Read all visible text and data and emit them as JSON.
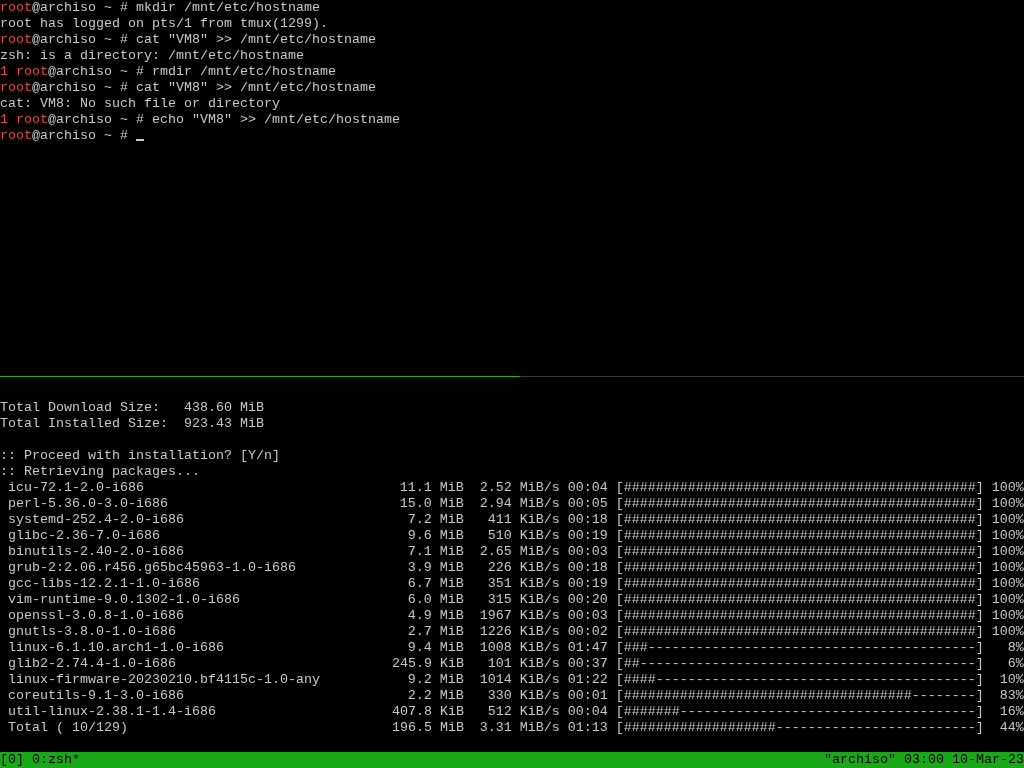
{
  "top_pane": {
    "lines": [
      {
        "kind": "prompt",
        "user": "root",
        "host": "@archiso ~ #",
        "command": "mkdir /mnt/etc/hostname"
      },
      {
        "kind": "output",
        "text": "root has logged on pts/1 from tmux(1299)."
      },
      {
        "kind": "prompt",
        "user": "root",
        "host": "@archiso ~ #",
        "command": "cat \"VM8\" >> /mnt/etc/hostname"
      },
      {
        "kind": "output",
        "text": "zsh: is a directory: /mnt/etc/hostname"
      },
      {
        "kind": "prompt",
        "exit_status": "1",
        "user": "root",
        "host": "@archiso ~ #",
        "command": "rmdir /mnt/etc/hostname"
      },
      {
        "kind": "prompt",
        "user": "root",
        "host": "@archiso ~ #",
        "command": "cat \"VM8\" >> /mnt/etc/hostname"
      },
      {
        "kind": "output",
        "text": "cat: VM8: No such file or directory"
      },
      {
        "kind": "prompt",
        "exit_status": "1",
        "user": "root",
        "host": "@archiso ~ #",
        "command": "echo \"VM8\" >> /mnt/etc/hostname"
      },
      {
        "kind": "prompt",
        "user": "root",
        "host": "@archiso ~ #",
        "cursor": true
      }
    ]
  },
  "bottom_pane": {
    "summary": [
      {
        "label": "Total Download Size:",
        "value": "438.60 MiB"
      },
      {
        "label": "Total Installed Size:",
        "value": "923.43 MiB"
      }
    ],
    "messages": [
      ":: Proceed with installation? [Y/n]",
      ":: Retrieving packages..."
    ],
    "downloads": [
      {
        "name": "icu-72.1-2.0-i686",
        "size": "11.1 MiB",
        "rate": "2.52 MiB/s",
        "eta": "00:04",
        "bar": "[############################################]",
        "percent": "100%"
      },
      {
        "name": "perl-5.36.0-3.0-i686",
        "size": "15.0 MiB",
        "rate": "2.94 MiB/s",
        "eta": "00:05",
        "bar": "[############################################]",
        "percent": "100%"
      },
      {
        "name": "systemd-252.4-2.0-i686",
        "size": "7.2 MiB",
        "rate": "411 KiB/s",
        "eta": "00:18",
        "bar": "[############################################]",
        "percent": "100%"
      },
      {
        "name": "glibc-2.36-7.0-i686",
        "size": "9.6 MiB",
        "rate": "510 KiB/s",
        "eta": "00:19",
        "bar": "[############################################]",
        "percent": "100%"
      },
      {
        "name": "binutils-2.40-2.0-i686",
        "size": "7.1 MiB",
        "rate": "2.65 MiB/s",
        "eta": "00:03",
        "bar": "[############################################]",
        "percent": "100%"
      },
      {
        "name": "grub-2:2.06.r456.g65bc45963-1.0-i686",
        "size": "3.9 MiB",
        "rate": "226 KiB/s",
        "eta": "00:18",
        "bar": "[############################################]",
        "percent": "100%"
      },
      {
        "name": "gcc-libs-12.2.1-1.0-i686",
        "size": "6.7 MiB",
        "rate": "351 KiB/s",
        "eta": "00:19",
        "bar": "[############################################]",
        "percent": "100%"
      },
      {
        "name": "vim-runtime-9.0.1302-1.0-i686",
        "size": "6.0 MiB",
        "rate": "315 KiB/s",
        "eta": "00:20",
        "bar": "[############################################]",
        "percent": "100%"
      },
      {
        "name": "openssl-3.0.8-1.0-i686",
        "size": "4.9 MiB",
        "rate": "1967 KiB/s",
        "eta": "00:03",
        "bar": "[############################################]",
        "percent": "100%"
      },
      {
        "name": "gnutls-3.8.0-1.0-i686",
        "size": "2.7 MiB",
        "rate": "1226 KiB/s",
        "eta": "00:02",
        "bar": "[############################################]",
        "percent": "100%"
      },
      {
        "name": "linux-6.1.10.arch1-1.0-i686",
        "size": "9.4 MiB",
        "rate": "1008 KiB/s",
        "eta": "01:47",
        "bar": "[###-----------------------------------------]",
        "percent": "8%"
      },
      {
        "name": "glib2-2.74.4-1.0-i686",
        "size": "245.9 KiB",
        "rate": "101 KiB/s",
        "eta": "00:37",
        "bar": "[##------------------------------------------]",
        "percent": "6%"
      },
      {
        "name": "linux-firmware-20230210.bf4115c-1.0-any",
        "size": "9.2 MiB",
        "rate": "1014 KiB/s",
        "eta": "01:22",
        "bar": "[####----------------------------------------]",
        "percent": "10%"
      },
      {
        "name": "coreutils-9.1-3.0-i686",
        "size": "2.2 MiB",
        "rate": "330 KiB/s",
        "eta": "00:01",
        "bar": "[####################################--------]",
        "percent": "83%"
      },
      {
        "name": "util-linux-2.38.1-1.4-i686",
        "size": "407.8 KiB",
        "rate": "512 KiB/s",
        "eta": "00:04",
        "bar": "[#######-------------------------------------]",
        "percent": "16%"
      },
      {
        "name": "Total ( 10/129)",
        "size": "196.5 MiB",
        "rate": "3.31 MiB/s",
        "eta": "01:13",
        "bar": "[###################-------------------------]",
        "percent": "44%"
      }
    ]
  },
  "status_bar": {
    "session": "[0]",
    "window": "0:zsh*",
    "right": "\"archiso\" 03:00 10-Mar-23"
  }
}
